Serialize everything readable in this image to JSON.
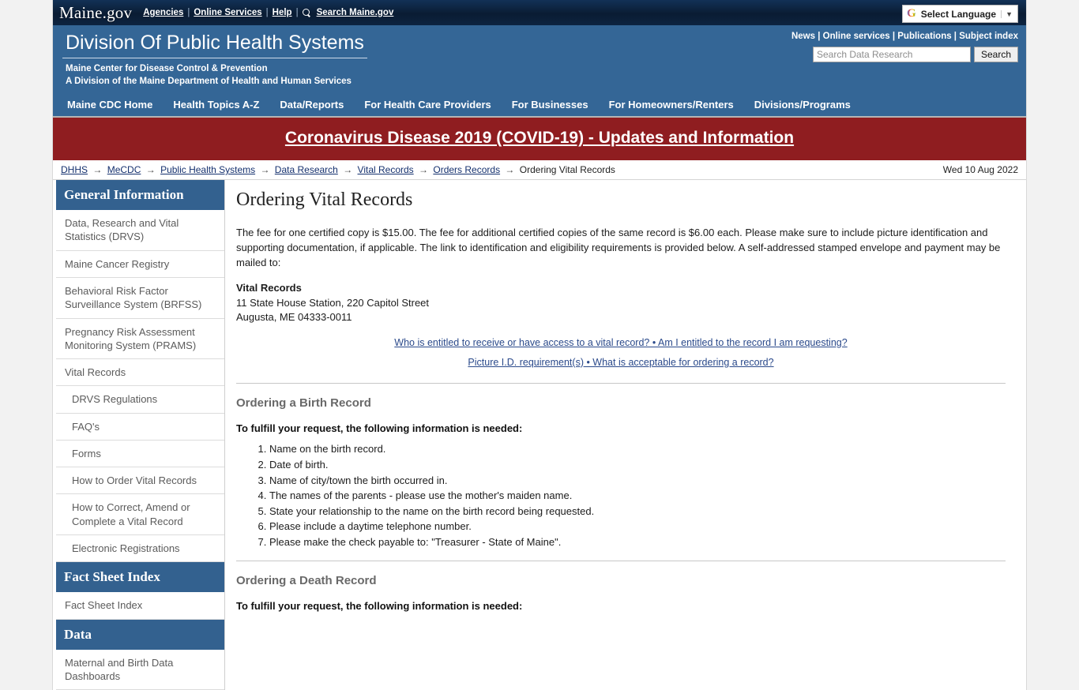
{
  "maine_bar": {
    "logo": "Maine.gov",
    "links": [
      {
        "label": "Agencies",
        "name": "agencies-link"
      },
      {
        "label": "Online Services",
        "name": "online-services-link"
      },
      {
        "label": "Help",
        "name": "help-link"
      },
      {
        "label": "Search Maine.gov",
        "name": "search-maine-link"
      }
    ],
    "separator": "|",
    "language": {
      "brand": "G",
      "label": "Select Language",
      "caret": "▼"
    }
  },
  "agency_header": {
    "title": "Division Of Public Health Systems",
    "subtitle_line1": "Maine Center for Disease Control & Prevention",
    "subtitle_line2": "A Division of the Maine Department of Health and Human Services",
    "top_links": "News | Online services | Publications | Subject index",
    "search": {
      "placeholder": "Search Data Research",
      "value": "",
      "button_label": "Search"
    },
    "nav": [
      {
        "label": "Maine CDC Home",
        "name": "nav-maine-cdc-home"
      },
      {
        "label": "Health Topics A-Z",
        "name": "nav-health-topics"
      },
      {
        "label": "Data/Reports",
        "name": "nav-data-reports"
      },
      {
        "label": "For Health Care Providers",
        "name": "nav-providers"
      },
      {
        "label": "For Businesses",
        "name": "nav-businesses"
      },
      {
        "label": "For Homeowners/Renters",
        "name": "nav-homeowners"
      },
      {
        "label": "Divisions/Programs",
        "name": "nav-divisions-programs"
      }
    ]
  },
  "covid_banner": {
    "label": "Coronavirus Disease 2019 (COVID-19) - Updates and Information"
  },
  "breadcrumb": {
    "arrow": "→",
    "items": [
      {
        "label": "DHHS",
        "link": true
      },
      {
        "label": "MeCDC",
        "link": true
      },
      {
        "label": "Public Health Systems",
        "link": true
      },
      {
        "label": "Data Research",
        "link": true
      },
      {
        "label": "Vital Records",
        "link": true
      },
      {
        "label": "Orders Records",
        "link": true
      },
      {
        "label": "Ordering Vital Records",
        "link": false
      }
    ],
    "date": "Wed 10 Aug 2022"
  },
  "sidebar": {
    "groups": [
      {
        "heading": "General Information",
        "items": [
          {
            "label": "Data, Research and Vital Statistics (DRVS)",
            "sub": false
          },
          {
            "label": "Maine Cancer Registry",
            "sub": false
          },
          {
            "label": "Behavioral Risk Factor Surveillance System (BRFSS)",
            "sub": false
          },
          {
            "label": "Pregnancy Risk Assessment Monitoring System (PRAMS)",
            "sub": false
          },
          {
            "label": "Vital Records",
            "sub": false
          },
          {
            "label": "DRVS Regulations",
            "sub": true
          },
          {
            "label": "FAQ's",
            "sub": true
          },
          {
            "label": "Forms",
            "sub": true
          },
          {
            "label": "How to Order Vital Records",
            "sub": true
          },
          {
            "label": "How to Correct, Amend or Complete a Vital Record",
            "sub": true
          },
          {
            "label": "Electronic Registrations",
            "sub": true
          }
        ]
      },
      {
        "heading": "Fact Sheet Index",
        "items": [
          {
            "label": "Fact Sheet Index",
            "sub": false
          }
        ]
      },
      {
        "heading": "Data",
        "items": [
          {
            "label": "Maternal and Birth Data Dashboards",
            "sub": false
          }
        ]
      }
    ]
  },
  "main": {
    "title": "Ordering Vital Records",
    "intro": "The fee for one certified copy is $15.00. The fee for additional certified copies of the same record is $6.00 each. Please make sure to include picture identification and supporting documentation, if applicable. The link to identification and eligibility requirements is provided below. A self-addressed stamped envelope and payment may be mailed to:",
    "address": {
      "name": "Vital Records",
      "line1": "11 State House Station, 220 Capitol Street",
      "line2": "Augusta, ME 04333-0011"
    },
    "eligibility_links": [
      "Who is entitled to receive or have access to a vital record? • Am I entitled to the record I am requesting?",
      "Picture I.D. requirement(s) • What is acceptable for ordering a record?"
    ],
    "sections": [
      {
        "heading": "Ordering a Birth Record",
        "lead": "To fulfill your request, the following information is needed:",
        "items": [
          "Name on the birth record.",
          "Date of birth.",
          "Name of city/town the birth occurred in.",
          "The names of the parents - please use the mother's maiden name.",
          "State your relationship to the name on the birth record being requested.",
          "Please include a daytime telephone number.",
          "Please make the check payable to: \"Treasurer - State of Maine\"."
        ]
      },
      {
        "heading": "Ordering a Death Record",
        "lead": "To fulfill your request, the following information is needed:",
        "items": []
      }
    ]
  },
  "colors": {
    "topbar": "#0d2340",
    "agency_blue": "#346696",
    "covid_red": "#8f1d20",
    "sidebar_heading": "#33618f",
    "link_blue": "#2b4a8b"
  }
}
